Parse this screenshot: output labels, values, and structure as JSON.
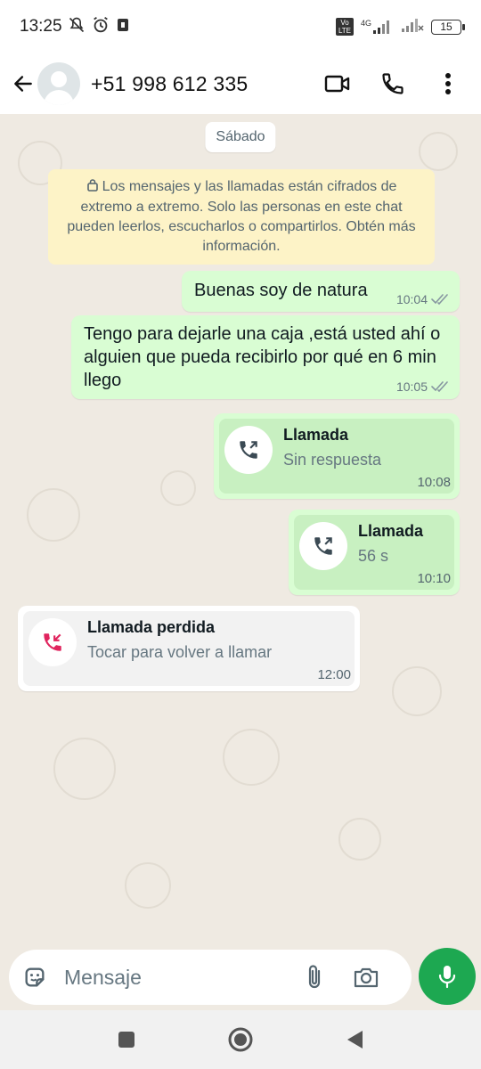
{
  "status_bar": {
    "time": "13:25",
    "signal_label": "4G",
    "lte_label": "Vo LTE",
    "battery": "15"
  },
  "header": {
    "contact_name": "+51 998 612 335"
  },
  "chat": {
    "date_chip": "Sábado",
    "encryption_note": "Los mensajes y las llamadas están cifrados de extremo a extremo. Solo las personas en este chat pueden leerlos, escucharlos o compartirlos. Obtén más información.",
    "messages": [
      {
        "text": "Buenas soy de natura",
        "time": "10:04"
      },
      {
        "text": "Tengo para dejarle una caja ,está usted ahí o alguien que pueda recibirlo por qué en 6 min llego",
        "time": "10:05"
      }
    ],
    "calls": [
      {
        "title": "Llamada",
        "subtitle": "Sin respuesta",
        "time": "10:08"
      },
      {
        "title": "Llamada",
        "subtitle": "56 s",
        "time": "10:10"
      },
      {
        "title": "Llamada perdida",
        "subtitle": "Tocar para volver a llamar",
        "time": "12:00"
      }
    ]
  },
  "input_bar": {
    "placeholder": "Mensaje"
  },
  "colors": {
    "outgoing_bubble": "#d9fdd3",
    "incoming_bubble": "#ffffff",
    "accent_green": "#1da851",
    "missed_call_red": "#e0245e",
    "chat_background": "#efeae2"
  }
}
